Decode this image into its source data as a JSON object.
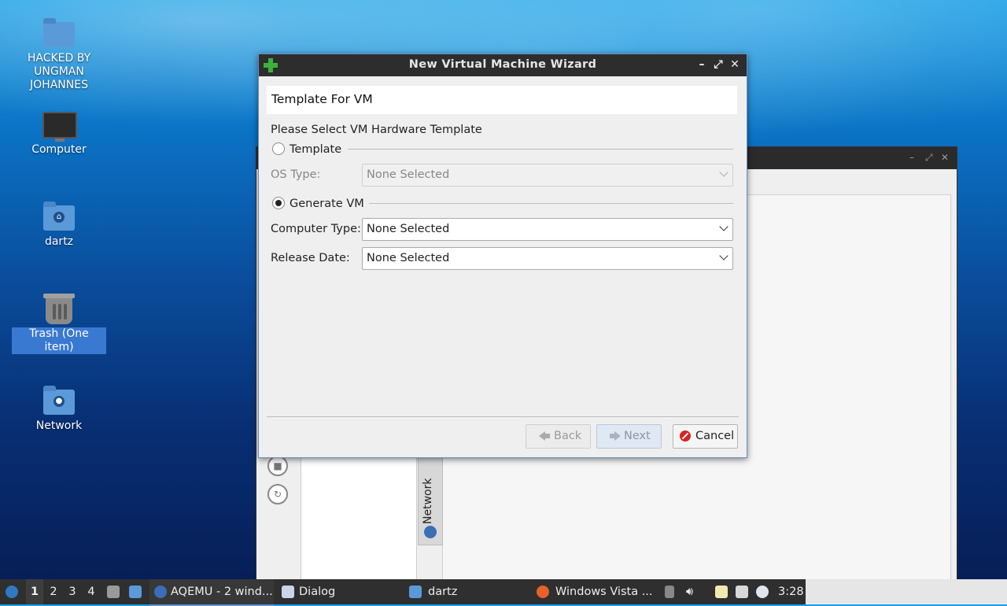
{
  "desktop": {
    "icons": [
      {
        "label_lines": [
          "HACKED BY",
          "UNGMAN",
          "JOHANNES"
        ],
        "icon": "folder-icon"
      },
      {
        "label": "Computer",
        "icon": "computer-icon"
      },
      {
        "label": "dartz",
        "icon": "home-folder-icon"
      },
      {
        "label": "Trash (One item)",
        "icon": "trash-icon"
      },
      {
        "label": "Network",
        "icon": "network-folder-icon"
      }
    ]
  },
  "background_window": {
    "tab_label": "Network"
  },
  "dialog": {
    "title": "New Virtual Machine Wizard",
    "header": "Template For VM",
    "prompt": "Please Select VM Hardware Template",
    "template_radio_label": "Template",
    "os_type_label": "OS Type:",
    "os_type_value": "None Selected",
    "generate_radio_label": "Generate VM",
    "computer_type_label": "Computer Type:",
    "computer_type_value": "None Selected",
    "release_date_label": "Release Date:",
    "release_date_value": "None Selected",
    "selected_option": "Generate VM",
    "buttons": {
      "back": "Back",
      "next": "Next",
      "cancel": "Cancel"
    }
  },
  "taskbar": {
    "workspaces": [
      "1",
      "2",
      "3",
      "4"
    ],
    "active_workspace": "1",
    "tasks": [
      {
        "label": "AQEMU - 2 wind...",
        "icon": "aqemu-icon"
      },
      {
        "label": "Dialog",
        "icon": "window-icon"
      },
      {
        "label": "dartz",
        "icon": "folder-icon"
      },
      {
        "label": "Windows Vista ...",
        "icon": "firefox-icon"
      }
    ],
    "clock": "3:28"
  }
}
